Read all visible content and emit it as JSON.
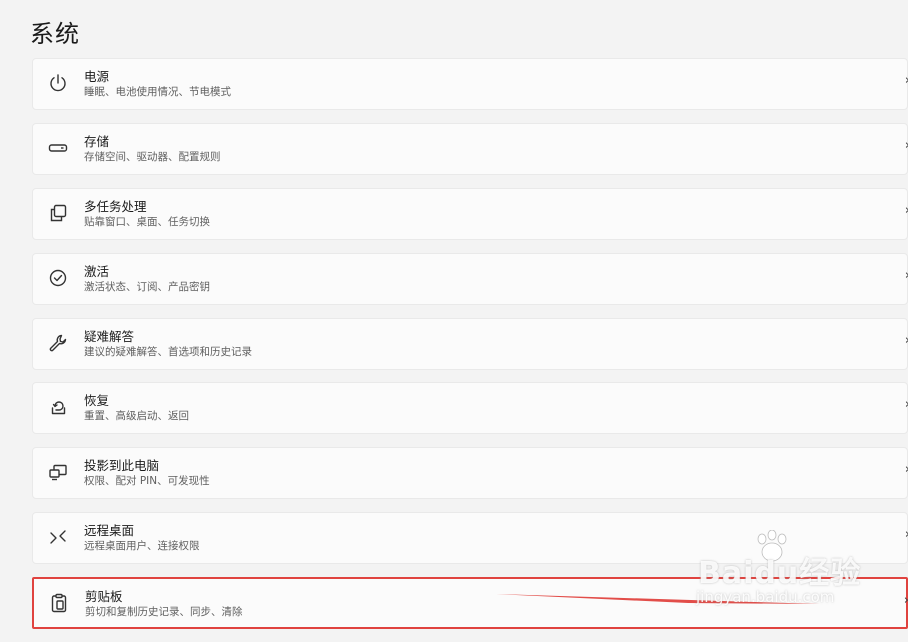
{
  "page": {
    "title": "系统"
  },
  "settings": {
    "items": [
      {
        "name": "power",
        "icon": "power-icon",
        "label": "电源",
        "desc": "睡眠、电池使用情况、节电模式",
        "highlighted": false
      },
      {
        "name": "storage",
        "icon": "storage-drive-icon",
        "label": "存储",
        "desc": "存储空间、驱动器、配置规则",
        "highlighted": false
      },
      {
        "name": "multitasking",
        "icon": "multitasking-icon",
        "label": "多任务处理",
        "desc": "贴靠窗口、桌面、任务切换",
        "highlighted": false
      },
      {
        "name": "activation",
        "icon": "check-circle-icon",
        "label": "激活",
        "desc": "激活状态、订阅、产品密钥",
        "highlighted": false
      },
      {
        "name": "troubleshoot",
        "icon": "wrench-icon",
        "label": "疑难解答",
        "desc": "建议的疑难解答、首选项和历史记录",
        "highlighted": false
      },
      {
        "name": "recovery",
        "icon": "recovery-icon",
        "label": "恢复",
        "desc": "重置、高级启动、返回",
        "highlighted": false
      },
      {
        "name": "projecting",
        "icon": "projection-icon",
        "label": "投影到此电脑",
        "desc": "权限、配对 PIN、可发现性",
        "highlighted": false
      },
      {
        "name": "remote-desktop",
        "icon": "remote-desktop-icon",
        "label": "远程桌面",
        "desc": "远程桌面用户、连接权限",
        "highlighted": false
      },
      {
        "name": "clipboard",
        "icon": "clipboard-icon",
        "label": "剪贴板",
        "desc": "剪切和复制历史记录、同步、清除",
        "highlighted": true
      }
    ],
    "chevron": "›"
  },
  "colors": {
    "highlight": "#e0433f",
    "background": "#f3f3f3",
    "card": "#fbfbfb"
  },
  "watermark": {
    "brand": "Baidu经验",
    "site": "jingyan.baidu.com"
  }
}
